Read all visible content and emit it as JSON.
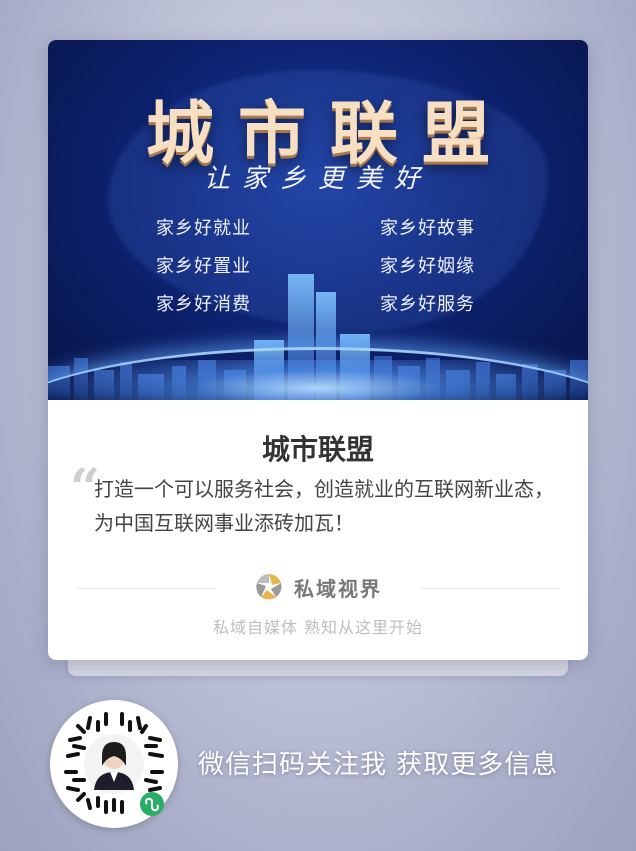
{
  "banner": {
    "title": "城市联盟",
    "subtitle": "让家乡更美好",
    "features_left": [
      "家乡好就业",
      "家乡好置业",
      "家乡好消费"
    ],
    "features_right": [
      "家乡好故事",
      "家乡好姻缘",
      "家乡好服务"
    ]
  },
  "article": {
    "title": "城市联盟",
    "description": "打造一个可以服务社会，创造就业的互联网新业态，为中国互联网事业添砖加瓦！"
  },
  "brand": {
    "name": "私域视界",
    "slogan": "私域自媒体  熟知从这里开始",
    "logo_icon": "aperture-logo-icon"
  },
  "footer": {
    "cta": "微信扫码关注我 获取更多信息",
    "qr_icon": "wechat-mini-program-qr-code"
  },
  "colors": {
    "banner_dark": "#071446",
    "banner_mid": "#1a3a9a",
    "title_gold": "#f6dfc2",
    "brand_gold": "#e7b64a",
    "wechat_green": "#2aae67"
  }
}
